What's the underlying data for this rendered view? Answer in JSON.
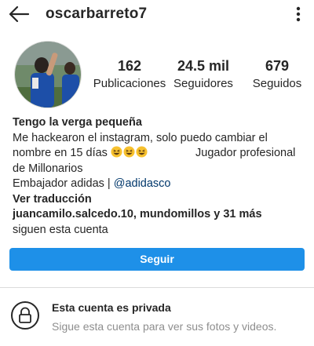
{
  "header": {
    "username": "oscarbarreto7",
    "back_icon": "arrow-left-icon",
    "menu_icon": "kebab-menu-icon"
  },
  "stats": {
    "posts_count": "162",
    "posts_label": "Publicaciones",
    "followers_count": "24.5 mil",
    "followers_label": "Seguidores",
    "following_count": "679",
    "following_label": "Seguidos"
  },
  "bio": {
    "name": "Tengo la verga pequeña",
    "line1": "Me hackearon el instagram, solo puedo cambiar el",
    "line2_start": "nombre en 15 días",
    "line2_end": "Jugador profesional",
    "line3": "de Millonarios",
    "line4_prefix": "Embajador adidas |",
    "mention": "@adidasco",
    "translate": "Ver traducción",
    "followed_by": "juancamilo.salcedo.10, mundomillos y 31 más",
    "followed_by_suffix": "siguen esta cuenta",
    "emoji": "grinning-squinting-face-emoji"
  },
  "actions": {
    "follow_label": "Seguir",
    "button_color": "#1e90e8"
  },
  "private": {
    "title": "Esta cuenta es privada",
    "subtitle": "Sigue esta cuenta para ver sus fotos y videos.",
    "icon": "lock-icon"
  }
}
